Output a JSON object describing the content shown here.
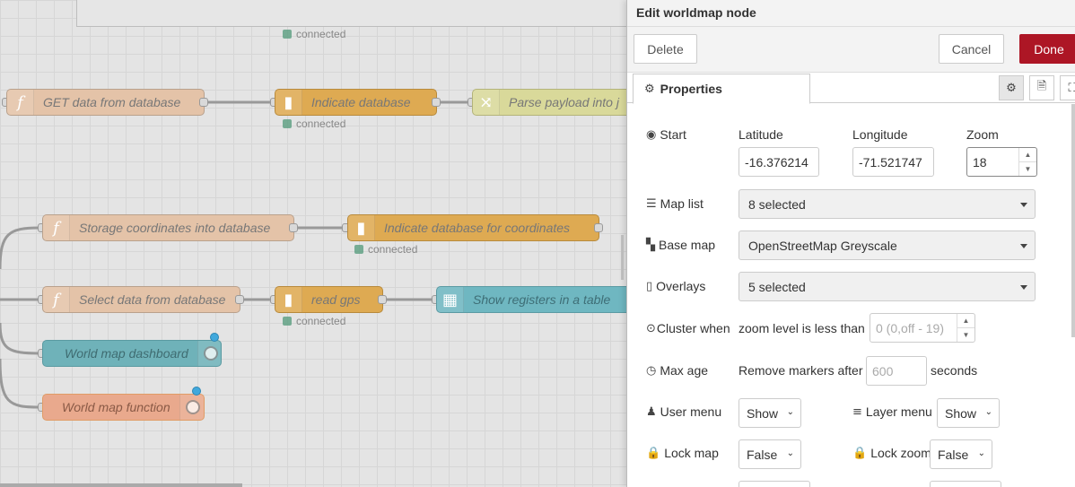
{
  "workspace": {
    "nodes": {
      "get_data": "GET data from database",
      "indicate_db": "Indicate database",
      "parse_payload": "Parse payload into j",
      "storage_coords": "Storage coordinates into database",
      "indicate_db_coords": "Indicate database for coordinates",
      "select_data": "Select data from database",
      "read_gps": "read gps",
      "show_registers": "Show registers in a table",
      "world_map_dashboard": "World map dashboard",
      "world_map_function": "World map function"
    },
    "status_text": "connected"
  },
  "tray": {
    "title": "Edit worldmap node",
    "delete_label": "Delete",
    "cancel_label": "Cancel",
    "done_label": "Done",
    "tab_properties": "Properties",
    "start_label": "Start",
    "latitude_label": "Latitude",
    "longitude_label": "Longitude",
    "zoom_label": "Zoom",
    "latitude_value": "-16.376214",
    "longitude_value": "-71.521747",
    "zoom_value": "18",
    "map_list_label": "Map list",
    "map_list_value": "8 selected",
    "base_map_label": "Base map",
    "base_map_value": "OpenStreetMap Greyscale",
    "overlays_label": "Overlays",
    "overlays_value": "5 selected",
    "cluster_label": "Cluster when",
    "cluster_text": "zoom level is less than",
    "cluster_placeholder": "0 (0,off - 19)",
    "max_age_label": "Max age",
    "max_age_text": "Remove markers after",
    "max_age_placeholder": "600",
    "max_age_unit": "seconds",
    "user_menu_label": "User menu",
    "user_menu_value": "Show",
    "layer_menu_label": "Layer menu",
    "layer_menu_value": "Show",
    "lock_map_label": "Lock map",
    "lock_map_value": "False",
    "lock_zoom_label": "Lock zoom",
    "lock_zoom_value": "False"
  },
  "colors": {
    "done_button": "#ad1625",
    "function_node": "#e4c3a8",
    "database_node": "#deaa52",
    "status_connected": "#5a9e80"
  },
  "icons": [
    "function-icon",
    "database-icon",
    "shuffle-icon",
    "table-icon",
    "globe-icon",
    "gear-icon",
    "file-icon",
    "frame-icon",
    "cog-icon",
    "list-icon",
    "map-icon",
    "open-map-icon",
    "target-icon",
    "clock-icon",
    "user-icon",
    "bars-icon",
    "lock-icon"
  ]
}
